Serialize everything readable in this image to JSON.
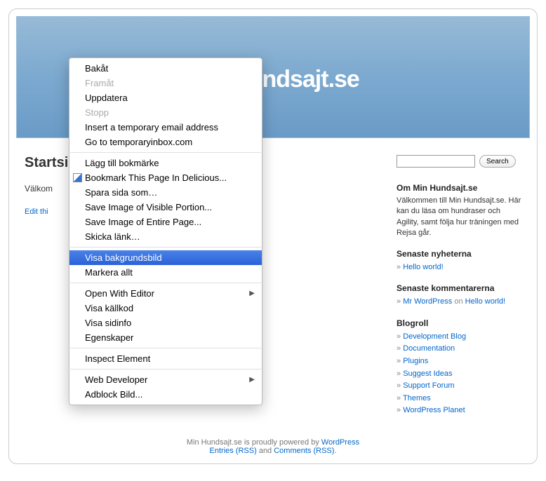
{
  "header": {
    "title": "Min Hundsajt.se"
  },
  "main": {
    "post_title": "Startsida",
    "welcome_prefix": "Välkom",
    "edit_link": "Edit thi"
  },
  "search": {
    "button": "Search"
  },
  "sidebar": {
    "about_title": "Om Min Hundsajt.se",
    "about_text": "Välkommen till Min Hundsajt.se. Här kan du läsa om hundraser och Agility, samt följa hur träningen med Rejsa går.",
    "news_title": "Senaste nyheterna",
    "news": [
      {
        "label": "Hello world!"
      }
    ],
    "comments_title": "Senaste kommentarerna",
    "comments": [
      {
        "author": "Mr WordPress",
        "on": " on ",
        "post": "Hello world!"
      }
    ],
    "blogroll_title": "Blogroll",
    "blogroll": [
      "Development Blog",
      "Documentation",
      "Plugins",
      "Suggest Ideas",
      "Support Forum",
      "Themes",
      "WordPress Planet"
    ]
  },
  "footer": {
    "text1": "Min Hundsajt.se is proudly powered by ",
    "wp": "WordPress",
    "entries": "Entries (RSS)",
    "and": " and ",
    "comments": "Comments (RSS)",
    "dot": "."
  },
  "context_menu": {
    "groups": [
      [
        {
          "label": "Bakåt",
          "disabled": false
        },
        {
          "label": "Framåt",
          "disabled": true
        },
        {
          "label": "Uppdatera",
          "disabled": false
        },
        {
          "label": "Stopp",
          "disabled": true
        },
        {
          "label": "Insert a temporary email address",
          "disabled": false
        },
        {
          "label": "Go to temporaryinbox.com",
          "disabled": false
        }
      ],
      [
        {
          "label": "Lägg till bokmärke",
          "disabled": false
        },
        {
          "label": "Bookmark This Page In Delicious...",
          "disabled": false,
          "icon": "delicious"
        },
        {
          "label": "Spara sida som…",
          "disabled": false
        },
        {
          "label": "Save Image of Visible Portion...",
          "disabled": false
        },
        {
          "label": "Save Image of Entire Page...",
          "disabled": false
        },
        {
          "label": "Skicka länk…",
          "disabled": false
        }
      ],
      [
        {
          "label": "Visa bakgrundsbild",
          "disabled": false,
          "selected": true
        },
        {
          "label": "Markera allt",
          "disabled": false
        }
      ],
      [
        {
          "label": "Open With Editor",
          "disabled": false,
          "submenu": true
        },
        {
          "label": "Visa källkod",
          "disabled": false
        },
        {
          "label": "Visa sidinfo",
          "disabled": false
        },
        {
          "label": "Egenskaper",
          "disabled": false
        }
      ],
      [
        {
          "label": "Inspect Element",
          "disabled": false
        }
      ],
      [
        {
          "label": "Web Developer",
          "disabled": false,
          "submenu": true
        },
        {
          "label": "Adblock Bild...",
          "disabled": false
        }
      ]
    ]
  }
}
